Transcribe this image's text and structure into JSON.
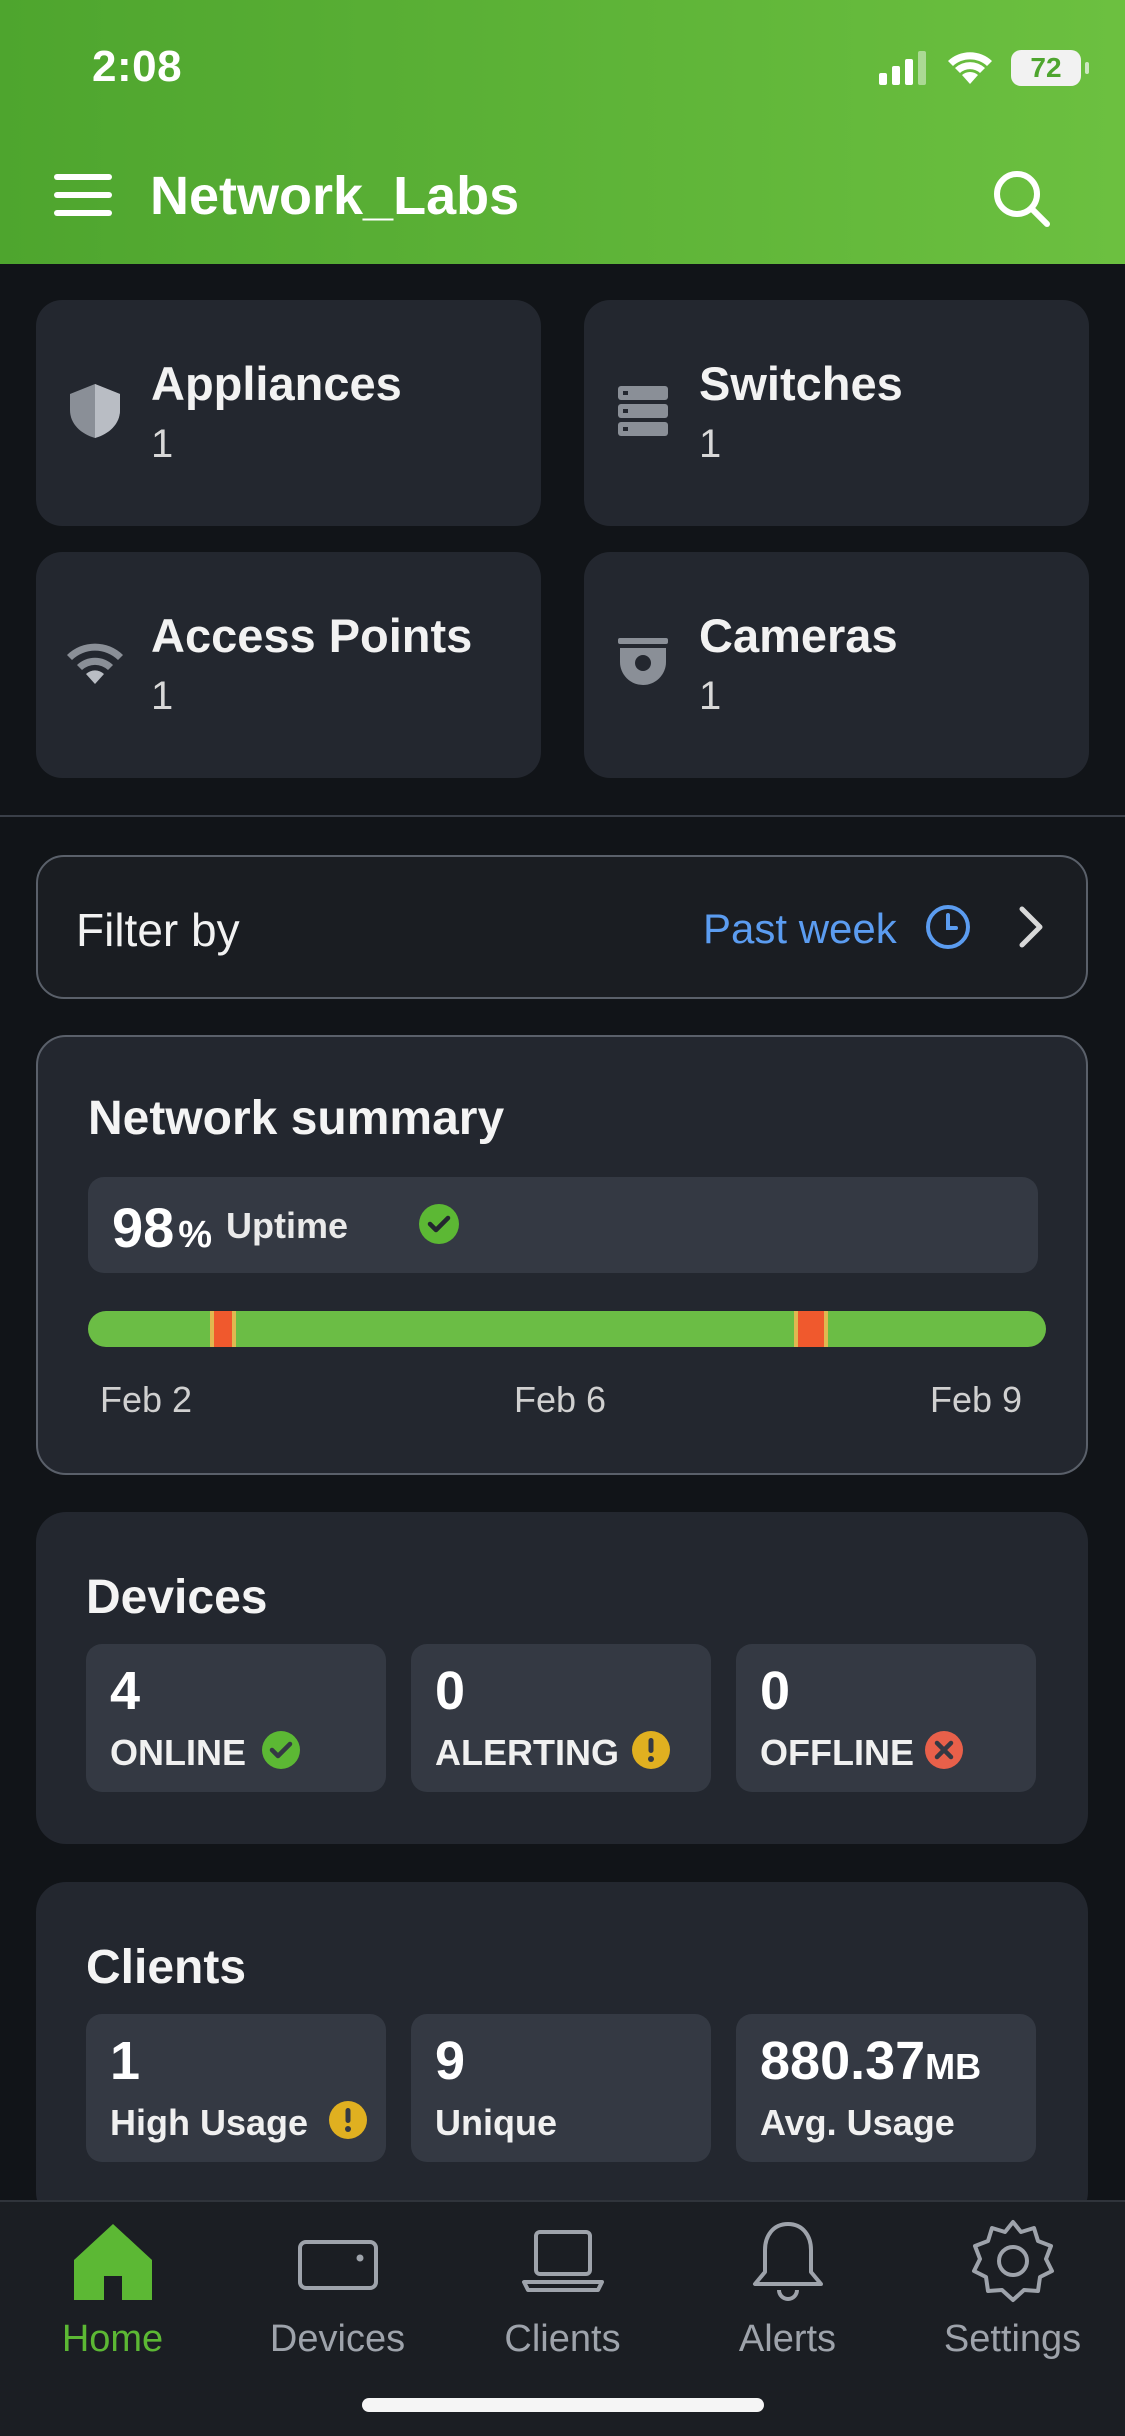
{
  "status_bar": {
    "time": "2:08",
    "battery": "72"
  },
  "header": {
    "title": "Network_Labs",
    "menu_icon": "hamburger-menu-icon",
    "search_icon": "search-icon"
  },
  "device_types": [
    {
      "label": "Appliances",
      "count": "1",
      "icon": "shield-icon"
    },
    {
      "label": "Switches",
      "count": "1",
      "icon": "switch-stack-icon"
    },
    {
      "label": "Access Points",
      "count": "1",
      "icon": "wifi-icon"
    },
    {
      "label": "Cameras",
      "count": "1",
      "icon": "camera-icon"
    }
  ],
  "filter": {
    "label": "Filter by",
    "value": "Past week"
  },
  "network_summary": {
    "title": "Network summary",
    "uptime_value": "98",
    "uptime_unit": "%",
    "uptime_label": "Uptime",
    "uptime_fraction": 0.98,
    "dates": [
      "Feb 2",
      "Feb 6",
      "Feb 9"
    ],
    "colors": {
      "up": "#6bbd45",
      "down": "#f0592d",
      "edge": "#e0b850"
    }
  },
  "devices": {
    "title": "Devices",
    "stats": [
      {
        "value": "4",
        "label": "ONLINE",
        "icon": "check-circle-icon"
      },
      {
        "value": "0",
        "label": "ALERTING",
        "icon": "warning-circle-icon"
      },
      {
        "value": "0",
        "label": "OFFLINE",
        "icon": "error-circle-icon"
      }
    ]
  },
  "clients": {
    "title": "Clients",
    "stats": [
      {
        "value": "1",
        "unit": "",
        "label": "High Usage",
        "icon": "warning-circle-icon"
      },
      {
        "value": "9",
        "unit": "",
        "label": "Unique"
      },
      {
        "value": "880.37",
        "unit": "MB",
        "label": "Avg. Usage"
      }
    ]
  },
  "tabs": [
    {
      "label": "Home",
      "icon": "home-icon",
      "active": true
    },
    {
      "label": "Devices",
      "icon": "device-icon",
      "active": false
    },
    {
      "label": "Clients",
      "icon": "laptop-icon",
      "active": false
    },
    {
      "label": "Alerts",
      "icon": "bell-icon",
      "active": false
    },
    {
      "label": "Settings",
      "icon": "gear-icon",
      "active": false
    }
  ],
  "accent_colors": {
    "brand_green": "#5cb834",
    "link_blue": "#5b9cf0",
    "ok": "#5cb834",
    "warn": "#e0b020",
    "error": "#e8604a"
  }
}
